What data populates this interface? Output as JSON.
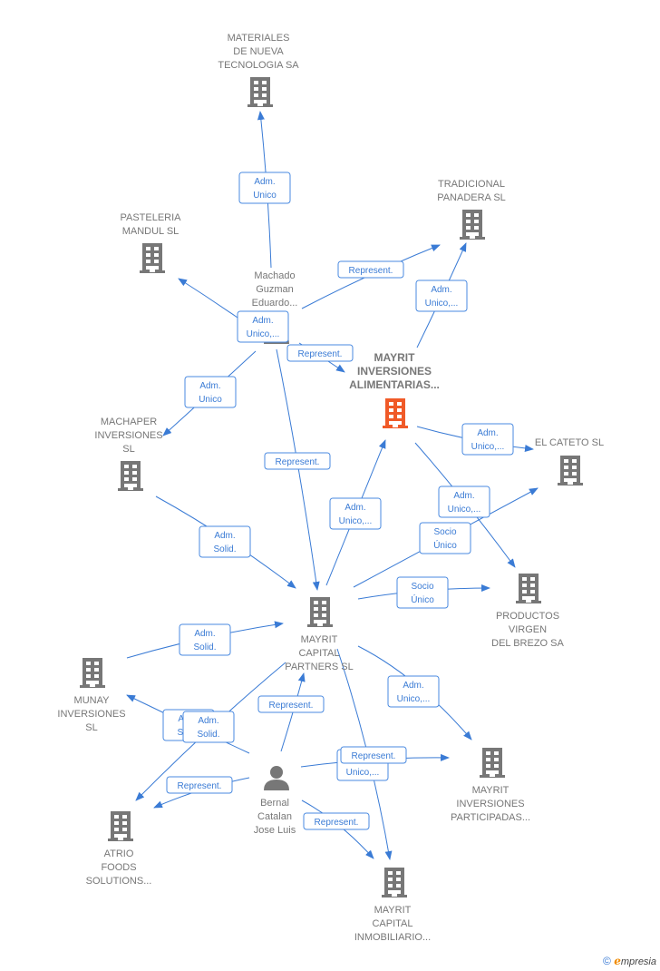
{
  "colors": {
    "edge": "#3a7bd5",
    "node": "#777777",
    "highlight": "#f05a28"
  },
  "nodes": [
    {
      "id": "materiales",
      "type": "company",
      "lines": [
        "MATERIALES",
        "DE NUEVA",
        "TECNOLOGIA SA"
      ]
    },
    {
      "id": "pasteleria",
      "type": "company",
      "lines": [
        "PASTELERIA",
        "MANDUL  SL"
      ]
    },
    {
      "id": "tradicional",
      "type": "company",
      "lines": [
        "TRADICIONAL",
        "PANADERA SL"
      ]
    },
    {
      "id": "machado",
      "type": "person",
      "lines": [
        "Machado",
        "Guzman",
        "Eduardo..."
      ]
    },
    {
      "id": "mayrit_alim",
      "type": "company",
      "highlight": true,
      "lines": [
        "MAYRIT",
        "INVERSIONES",
        "ALIMENTARIAS..."
      ]
    },
    {
      "id": "el_cateto",
      "type": "company",
      "lines": [
        "EL CATETO SL"
      ]
    },
    {
      "id": "machaper",
      "type": "company",
      "lines": [
        "MACHAPER",
        "INVERSIONES",
        "SL"
      ]
    },
    {
      "id": "mcp",
      "type": "company",
      "lines": [
        "MAYRIT",
        "CAPITAL",
        "PARTNERS  SL"
      ]
    },
    {
      "id": "productos",
      "type": "company",
      "lines": [
        "PRODUCTOS",
        "VIRGEN",
        "DEL BREZO SA"
      ]
    },
    {
      "id": "munay",
      "type": "company",
      "lines": [
        "MUNAY",
        "INVERSIONES",
        "SL"
      ]
    },
    {
      "id": "mayrit_part",
      "type": "company",
      "lines": [
        "MAYRIT",
        "INVERSIONES",
        "PARTICIPADAS..."
      ]
    },
    {
      "id": "bernal",
      "type": "person",
      "lines": [
        "Bernal",
        "Catalan",
        "Jose Luis"
      ]
    },
    {
      "id": "atrio",
      "type": "company",
      "lines": [
        "ATRIO",
        "FOODS",
        "SOLUTIONS..."
      ]
    },
    {
      "id": "mayrit_inmob",
      "type": "company",
      "lines": [
        "MAYRIT",
        "CAPITAL",
        "INMOBILIARIO..."
      ]
    }
  ],
  "edges": [
    {
      "from": "machado",
      "to": "materiales",
      "label": [
        "Adm.",
        "Unico"
      ]
    },
    {
      "from": "machado",
      "to": "pasteleria",
      "label": [
        "Adm.",
        "Unico,..."
      ]
    },
    {
      "from": "machado",
      "to": "tradicional",
      "label": [
        "Represent."
      ]
    },
    {
      "from": "machado",
      "to": "mayrit_alim",
      "label": [
        "Represent."
      ]
    },
    {
      "from": "machado",
      "to": "machaper",
      "label": [
        "Adm.",
        "Unico"
      ]
    },
    {
      "from": "machado",
      "to": "mcp",
      "label": [
        "Represent."
      ]
    },
    {
      "from": "mayrit_alim",
      "to": "tradicional",
      "label": [
        "Adm.",
        "Unico,..."
      ]
    },
    {
      "from": "mcp",
      "to": "mayrit_alim",
      "label": [
        "Adm.",
        "Unico,..."
      ]
    },
    {
      "from": "mayrit_alim",
      "to": "el_cateto",
      "label": [
        "Adm.",
        "Unico,..."
      ]
    },
    {
      "from": "mayrit_alim",
      "to": "productos",
      "label": [
        "Adm.",
        "Unico,..."
      ]
    },
    {
      "from": "mcp",
      "to": "el_cateto",
      "label": [
        "Socio",
        "Único"
      ]
    },
    {
      "from": "mcp",
      "to": "productos",
      "label": [
        "Socio",
        "Único"
      ]
    },
    {
      "from": "machaper",
      "to": "mcp",
      "label": [
        "Adm.",
        "Solid."
      ]
    },
    {
      "from": "munay",
      "to": "mcp",
      "label": [
        "Adm.",
        "Solid."
      ]
    },
    {
      "from": "mcp",
      "to": "mayrit_part",
      "label": [
        "Adm.",
        "Unico,..."
      ]
    },
    {
      "from": "mcp",
      "to": "mayrit_inmob",
      "label": [
        "Adm.",
        "Unico,..."
      ]
    },
    {
      "from": "bernal",
      "to": "munay",
      "label": [
        "Adm.",
        "Solid."
      ]
    },
    {
      "from": "mcp",
      "to": "atrio",
      "label": [
        "Adm.",
        "Solid."
      ]
    },
    {
      "from": "bernal",
      "to": "mcp",
      "label": [
        "Represent."
      ]
    },
    {
      "from": "bernal",
      "to": "atrio",
      "label": [
        "Represent."
      ]
    },
    {
      "from": "bernal",
      "to": "mayrit_part",
      "label": [
        "Represent."
      ]
    },
    {
      "from": "bernal",
      "to": "mayrit_inmob",
      "label": [
        "Represent."
      ]
    }
  ],
  "footer": {
    "copyright": "©",
    "brand_initial": "e",
    "brand_rest": "mpresia"
  }
}
